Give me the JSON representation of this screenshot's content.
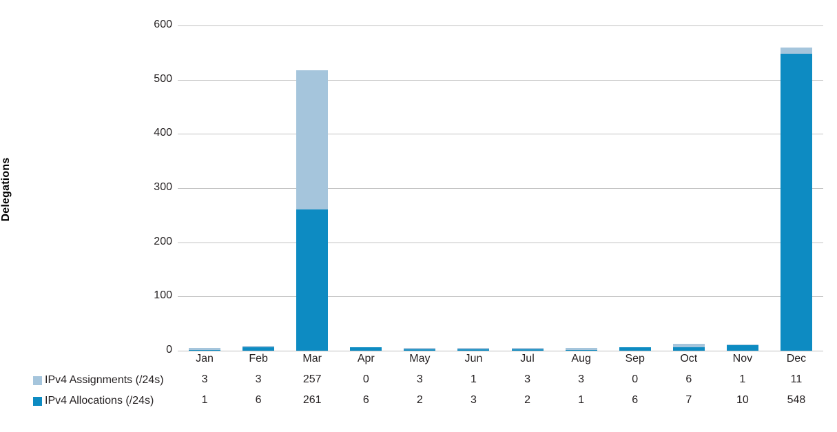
{
  "chart_data": {
    "type": "bar",
    "stacked": true,
    "title": "",
    "subtitle": "",
    "xlabel": "",
    "ylabel": "Delegations",
    "ylim": [
      0,
      600
    ],
    "ytick_values": [
      0,
      100,
      200,
      300,
      400,
      500,
      600
    ],
    "ytick_labels": [
      "0",
      "100",
      "200",
      "300",
      "400",
      "500",
      "600"
    ],
    "grid": true,
    "legend_position": "left-below-axis-table",
    "categories": [
      "Jan",
      "Feb",
      "Mar",
      "Apr",
      "May",
      "Jun",
      "Jul",
      "Aug",
      "Sep",
      "Oct",
      "Nov",
      "Dec"
    ],
    "series": [
      {
        "name": "IPv4 Assignments (/24s)",
        "color": "#a5c5dc",
        "stack_order": 2,
        "values": [
          3,
          3,
          257,
          0,
          3,
          1,
          3,
          3,
          0,
          6,
          1,
          11
        ]
      },
      {
        "name": "IPv4 Allocations (/24s)",
        "color": "#0d8bc2",
        "stack_order": 1,
        "values": [
          1,
          6,
          261,
          6,
          2,
          3,
          2,
          1,
          6,
          7,
          10,
          548
        ]
      }
    ],
    "totals": [
      4,
      9,
      518,
      6,
      5,
      4,
      5,
      4,
      6,
      13,
      11,
      559
    ]
  },
  "axis": {
    "y_title": "Delegations"
  },
  "colors": {
    "assignments": "#a5c5dc",
    "allocations": "#0d8bc2",
    "gridline": "#c0c0c0",
    "axis": "#bfbfbf",
    "text": "#231f20",
    "background": "#ffffff"
  },
  "data_table": {
    "rows": [
      {
        "label": "IPv4 Assignments (/24s)",
        "swatch_color": "#a5c5dc",
        "values": [
          "3",
          "3",
          "257",
          "0",
          "3",
          "1",
          "3",
          "3",
          "0",
          "6",
          "1",
          "11"
        ]
      },
      {
        "label": "IPv4 Allocations (/24s)",
        "swatch_color": "#0d8bc2",
        "values": [
          "1",
          "6",
          "261",
          "6",
          "2",
          "3",
          "2",
          "1",
          "6",
          "7",
          "10",
          "548"
        ]
      }
    ]
  }
}
